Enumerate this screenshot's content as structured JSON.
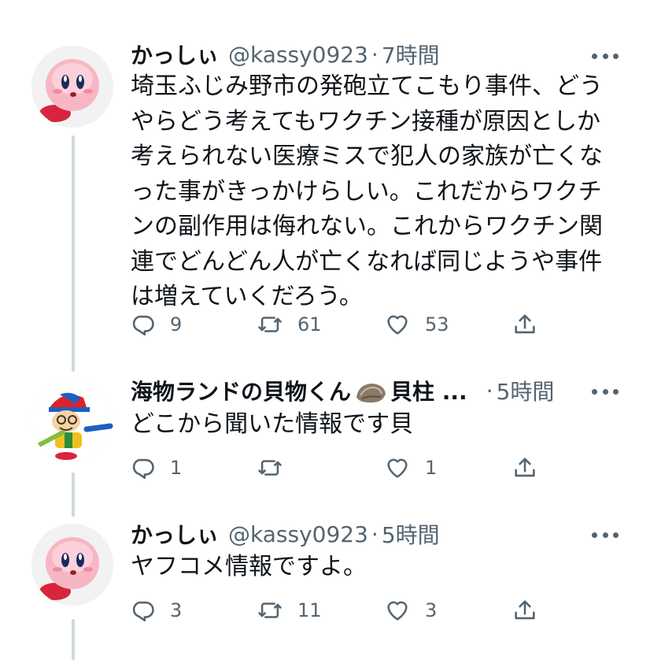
{
  "tweets": [
    {
      "name": "かっしぃ",
      "handle": "@kassy0923",
      "separator": "·",
      "time": "7時間",
      "lines": [
        "埼玉ふじみ野市の発砲立てこもり事件、どう",
        "やらどう考えてもワクチン接種が原因としか",
        "考えられない医療ミスで犯人の家族が亡くな",
        "った事がきっかけらしい。これだからワクチ",
        "ンの副作用は侮れない。これからワクチン関",
        "連でどんどん人が亡くなれば同じようや事件",
        "は増えていくだろう。"
      ],
      "replies": "9",
      "retweets": "61",
      "likes": "53"
    },
    {
      "name_pre": "海物ランドの貝物くん",
      "name_post": "貝柱 ...",
      "separator": "·",
      "time": "5時間",
      "lines": [
        "どこから聞いた情報です貝"
      ],
      "replies": "1",
      "retweets": "",
      "likes": "1"
    },
    {
      "name": "かっしぃ",
      "handle": "@kassy0923",
      "separator": "·",
      "time": "5時間",
      "lines": [
        "ヤフコメ情報ですよ。"
      ],
      "replies": "3",
      "retweets": "11",
      "likes": "3"
    }
  ],
  "icons": {
    "reply": "reply-icon",
    "retweet": "retweet-icon",
    "like": "heart-icon",
    "share": "share-icon",
    "more": "more-icon",
    "oyster": "oyster-emoji"
  },
  "colors": {
    "text": "#0f1419",
    "secondary": "#536471",
    "thread_line": "#cfd9de",
    "kirby_pink": "#f7b6c4",
    "kirby_feet": "#d8243c"
  }
}
